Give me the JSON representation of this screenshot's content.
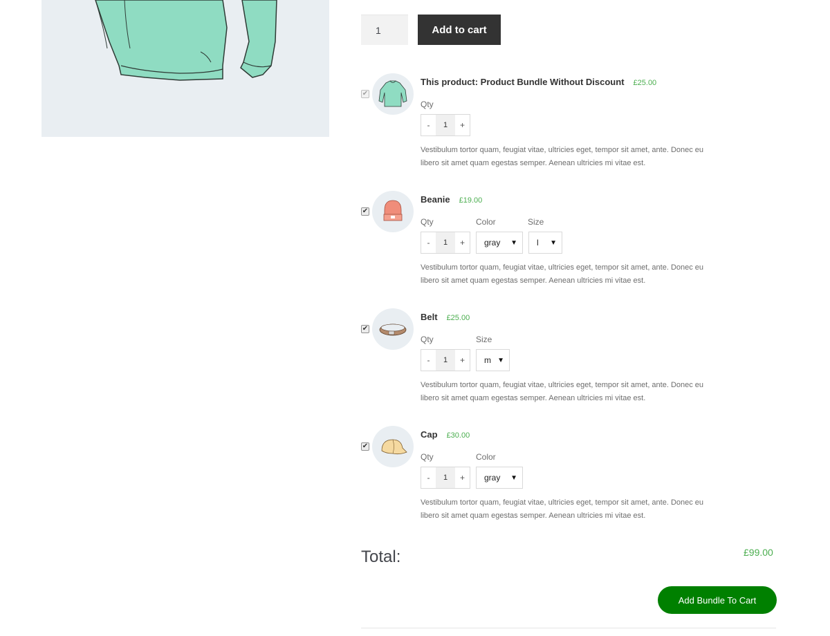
{
  "product": {
    "quantity": "1",
    "add_to_cart_label": "Add to cart"
  },
  "labels": {
    "qty": "Qty",
    "color": "Color",
    "size": "Size",
    "minus": "-",
    "plus": "+"
  },
  "bundle_items": [
    {
      "title": "This product: Product Bundle Without Discount",
      "price": "£25.00",
      "checked": true,
      "disabled": true,
      "image": "hoodie",
      "qty": "1",
      "description": "Vestibulum tortor quam, feugiat vitae, ultricies eget, tempor sit amet, ante. Donec eu libero sit amet quam egestas semper. Aenean ultricies mi vitae est."
    },
    {
      "title": "Beanie",
      "price": "£19.00",
      "checked": true,
      "image": "beanie",
      "qty": "1",
      "color": "gray",
      "size": "l",
      "description": "Vestibulum tortor quam, feugiat vitae, ultricies eget, tempor sit amet, ante. Donec eu libero sit amet quam egestas semper. Aenean ultricies mi vitae est."
    },
    {
      "title": "Belt",
      "price": "£25.00",
      "checked": true,
      "image": "belt",
      "qty": "1",
      "size": "m",
      "description": "Vestibulum tortor quam, feugiat vitae, ultricies eget, tempor sit amet, ante. Donec eu libero sit amet quam egestas semper. Aenean ultricies mi vitae est."
    },
    {
      "title": "Cap",
      "price": "£30.00",
      "checked": true,
      "image": "cap",
      "qty": "1",
      "color": "gray",
      "description": "Vestibulum tortor quam, feugiat vitae, ultricies eget, tempor sit amet, ante. Donec eu libero sit amet quam egestas semper. Aenean ultricies mi vitae est."
    }
  ],
  "totals": {
    "label": "Total:",
    "value": "£99.00"
  },
  "bundle_button_label": "Add Bundle To Cart",
  "colors": {
    "price_green": "#4bae4f",
    "bundle_button": "#008000",
    "add_to_cart_button": "#333333",
    "image_background": "#e9eef2",
    "hoodie": "#8fdcc2"
  }
}
